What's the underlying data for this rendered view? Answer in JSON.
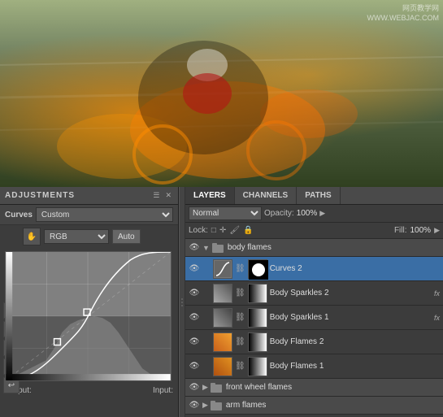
{
  "watermark": {
    "line1": "网页教学网",
    "line2": "WWW.WEBJAC.COM"
  },
  "photo": {
    "description": "Cyclist on mountain bike with motion blur and fire effect"
  },
  "adjustments": {
    "title": "ADJUSTMENTS",
    "curves_label": "Curves",
    "preset_label": "Custom",
    "channel_label": "RGB",
    "auto_label": "Auto",
    "output_label": "Output:",
    "input_label": "Input:"
  },
  "layers": {
    "tabs": [
      "LAYERS",
      "CHANNELS",
      "PATHS"
    ],
    "active_tab": "LAYERS",
    "blend_mode": "Normal",
    "opacity_label": "Opacity:",
    "opacity_value": "100%",
    "fill_label": "Fill:",
    "fill_value": "100%",
    "lock_label": "Lock:",
    "items": [
      {
        "name": "body flames",
        "type": "group",
        "visible": true,
        "selected": false,
        "indent": 0
      },
      {
        "name": "Curves 2",
        "type": "curves",
        "visible": true,
        "selected": true,
        "indent": 1,
        "has_mask": true
      },
      {
        "name": "Body Sparkles 2",
        "type": "layer",
        "visible": true,
        "selected": false,
        "indent": 1,
        "has_fx": true
      },
      {
        "name": "Body Sparkles 1",
        "type": "layer",
        "visible": true,
        "selected": false,
        "indent": 1,
        "has_fx": true
      },
      {
        "name": "Body Flames 2",
        "type": "layer",
        "visible": true,
        "selected": false,
        "indent": 1
      },
      {
        "name": "Body Flames 1",
        "type": "layer",
        "visible": true,
        "selected": false,
        "indent": 1
      },
      {
        "name": "front wheel flames",
        "type": "group",
        "visible": true,
        "selected": false,
        "indent": 0
      },
      {
        "name": "arm flames",
        "type": "group",
        "visible": true,
        "selected": false,
        "indent": 0
      }
    ]
  }
}
